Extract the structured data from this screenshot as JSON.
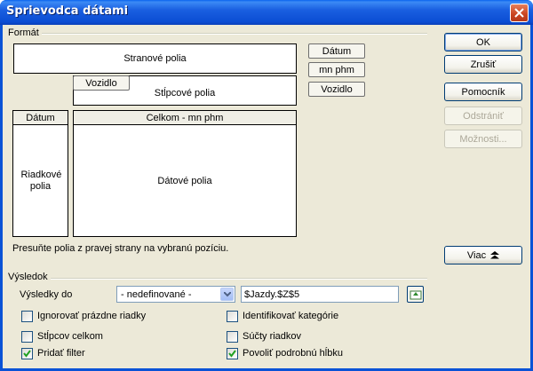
{
  "window": {
    "title": "Sprievodca dátami"
  },
  "format_group": {
    "label": "Formát",
    "page_fields_label": "Stranové polia",
    "column_fields_label": "Stĺpcové polia",
    "column_field_item": "Vozidlo",
    "row_header": "Dátum",
    "row_fields_label": "Riadkové polia",
    "data_header": "Celkom - mn phm",
    "data_fields_label": "Dátové polia",
    "available_fields": [
      "Dátum",
      "mn phm",
      "Vozidlo"
    ],
    "hint": "Presuňte polia z pravej strany na vybranú pozíciu."
  },
  "buttons": {
    "ok": "OK",
    "cancel": "Zrušiť",
    "help": "Pomocník",
    "remove": "Odstrániť",
    "options": "Možnosti...",
    "more": "Viac"
  },
  "result_group": {
    "label": "Výsledok",
    "results_to_label": "Výsledky do",
    "results_to_value": "- nedefinované -",
    "destination_value": "$Jazdy.$Z$5",
    "checkboxes": {
      "ignore_empty": {
        "label": "Ignorovať prázdne riadky",
        "checked": false
      },
      "identify_categories": {
        "label": "Identifikovať kategórie",
        "checked": false
      },
      "column_totals": {
        "label": "Stĺpcov celkom",
        "checked": false
      },
      "row_totals": {
        "label": "Súčty riadkov",
        "checked": false
      },
      "add_filter": {
        "label": "Pridať filter",
        "checked": true
      },
      "allow_drilldown": {
        "label": "Povoliť podrobnú hĺbku",
        "checked": true
      }
    }
  },
  "colors": {
    "titlebar": "#0b4dd3",
    "dialog_bg": "#ece9d8",
    "check_mark": "#21a121"
  }
}
